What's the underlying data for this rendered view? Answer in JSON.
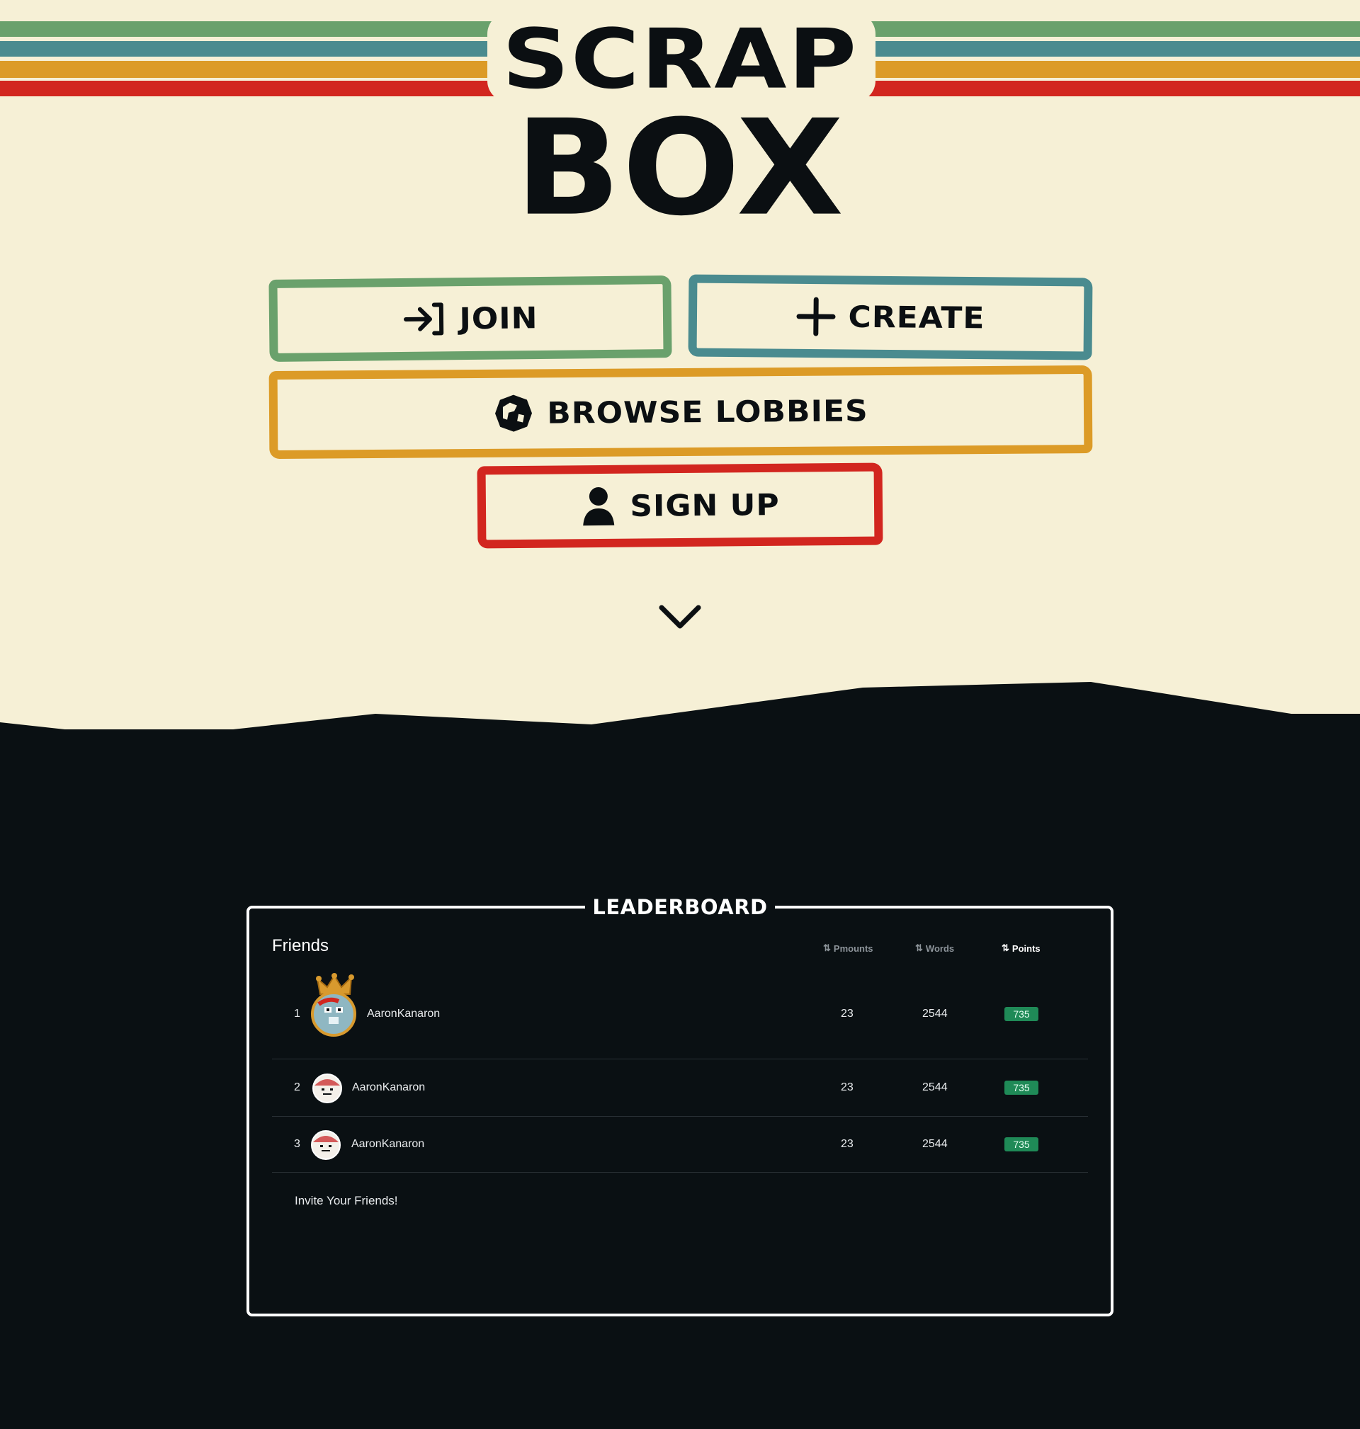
{
  "logo": {
    "line1": "SCRAP",
    "line2": "BOX"
  },
  "stripe_colors": [
    "#6aa16c",
    "#4a8b8f",
    "#dc9b27",
    "#d2261f"
  ],
  "buttons": {
    "join": {
      "label": "JOIN",
      "icon": "enter-arrow-icon",
      "color": "#6aa16c"
    },
    "create": {
      "label": "CREATE",
      "icon": "plus-icon",
      "color": "#4a8b8f"
    },
    "browse": {
      "label": "BROWSE LOBBIES",
      "icon": "globe-icon",
      "color": "#dc9b27"
    },
    "signup": {
      "label": "SIGN UP",
      "icon": "user-icon",
      "color": "#d2261f"
    }
  },
  "scroll_icon": "chevron-down-icon",
  "leaderboard": {
    "title": "LEADERBOARD",
    "group": "Friends",
    "columns": [
      {
        "label": "Pmounts",
        "active": false
      },
      {
        "label": "Words",
        "active": false
      },
      {
        "label": "Points",
        "active": true
      }
    ],
    "rows": [
      {
        "rank": "1",
        "name": "AaronKanaron",
        "pmounts": "23",
        "words": "2544",
        "points": "735",
        "crown": true
      },
      {
        "rank": "2",
        "name": "AaronKanaron",
        "pmounts": "23",
        "words": "2544",
        "points": "735",
        "crown": false
      },
      {
        "rank": "3",
        "name": "AaronKanaron",
        "pmounts": "23",
        "words": "2544",
        "points": "735",
        "crown": false
      }
    ],
    "invite_text": "Invite Your Friends!",
    "points_color": "#1f8a57"
  },
  "colors": {
    "background": "#f6f0d6",
    "dark": "#0a1013",
    "ink": "#0b0f12"
  }
}
